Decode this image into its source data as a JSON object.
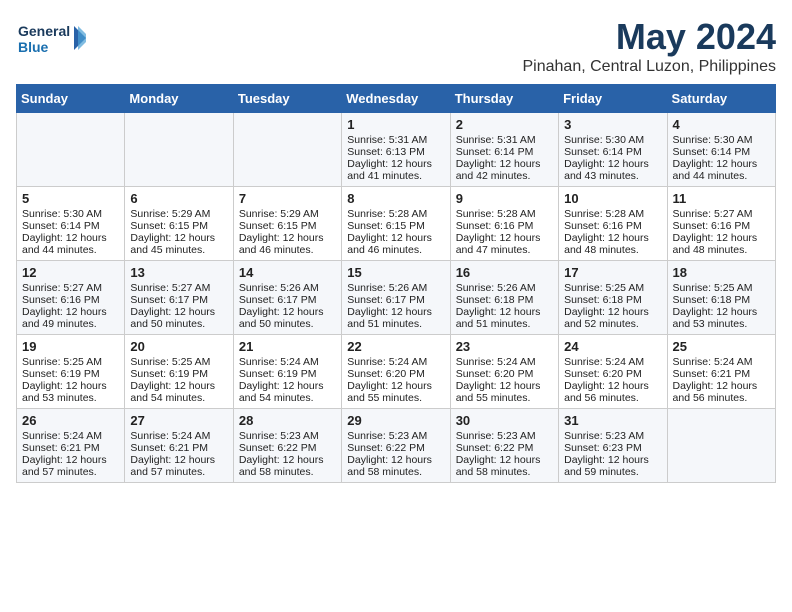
{
  "logo": {
    "line1": "General",
    "line2": "Blue"
  },
  "title": "May 2024",
  "subtitle": "Pinahan, Central Luzon, Philippines",
  "days_of_week": [
    "Sunday",
    "Monday",
    "Tuesday",
    "Wednesday",
    "Thursday",
    "Friday",
    "Saturday"
  ],
  "weeks": [
    [
      {
        "day": "",
        "sunrise": "",
        "sunset": "",
        "daylight": ""
      },
      {
        "day": "",
        "sunrise": "",
        "sunset": "",
        "daylight": ""
      },
      {
        "day": "",
        "sunrise": "",
        "sunset": "",
        "daylight": ""
      },
      {
        "day": "1",
        "sunrise": "Sunrise: 5:31 AM",
        "sunset": "Sunset: 6:13 PM",
        "daylight": "Daylight: 12 hours and 41 minutes."
      },
      {
        "day": "2",
        "sunrise": "Sunrise: 5:31 AM",
        "sunset": "Sunset: 6:14 PM",
        "daylight": "Daylight: 12 hours and 42 minutes."
      },
      {
        "day": "3",
        "sunrise": "Sunrise: 5:30 AM",
        "sunset": "Sunset: 6:14 PM",
        "daylight": "Daylight: 12 hours and 43 minutes."
      },
      {
        "day": "4",
        "sunrise": "Sunrise: 5:30 AM",
        "sunset": "Sunset: 6:14 PM",
        "daylight": "Daylight: 12 hours and 44 minutes."
      }
    ],
    [
      {
        "day": "5",
        "sunrise": "Sunrise: 5:30 AM",
        "sunset": "Sunset: 6:14 PM",
        "daylight": "Daylight: 12 hours and 44 minutes."
      },
      {
        "day": "6",
        "sunrise": "Sunrise: 5:29 AM",
        "sunset": "Sunset: 6:15 PM",
        "daylight": "Daylight: 12 hours and 45 minutes."
      },
      {
        "day": "7",
        "sunrise": "Sunrise: 5:29 AM",
        "sunset": "Sunset: 6:15 PM",
        "daylight": "Daylight: 12 hours and 46 minutes."
      },
      {
        "day": "8",
        "sunrise": "Sunrise: 5:28 AM",
        "sunset": "Sunset: 6:15 PM",
        "daylight": "Daylight: 12 hours and 46 minutes."
      },
      {
        "day": "9",
        "sunrise": "Sunrise: 5:28 AM",
        "sunset": "Sunset: 6:16 PM",
        "daylight": "Daylight: 12 hours and 47 minutes."
      },
      {
        "day": "10",
        "sunrise": "Sunrise: 5:28 AM",
        "sunset": "Sunset: 6:16 PM",
        "daylight": "Daylight: 12 hours and 48 minutes."
      },
      {
        "day": "11",
        "sunrise": "Sunrise: 5:27 AM",
        "sunset": "Sunset: 6:16 PM",
        "daylight": "Daylight: 12 hours and 48 minutes."
      }
    ],
    [
      {
        "day": "12",
        "sunrise": "Sunrise: 5:27 AM",
        "sunset": "Sunset: 6:16 PM",
        "daylight": "Daylight: 12 hours and 49 minutes."
      },
      {
        "day": "13",
        "sunrise": "Sunrise: 5:27 AM",
        "sunset": "Sunset: 6:17 PM",
        "daylight": "Daylight: 12 hours and 50 minutes."
      },
      {
        "day": "14",
        "sunrise": "Sunrise: 5:26 AM",
        "sunset": "Sunset: 6:17 PM",
        "daylight": "Daylight: 12 hours and 50 minutes."
      },
      {
        "day": "15",
        "sunrise": "Sunrise: 5:26 AM",
        "sunset": "Sunset: 6:17 PM",
        "daylight": "Daylight: 12 hours and 51 minutes."
      },
      {
        "day": "16",
        "sunrise": "Sunrise: 5:26 AM",
        "sunset": "Sunset: 6:18 PM",
        "daylight": "Daylight: 12 hours and 51 minutes."
      },
      {
        "day": "17",
        "sunrise": "Sunrise: 5:25 AM",
        "sunset": "Sunset: 6:18 PM",
        "daylight": "Daylight: 12 hours and 52 minutes."
      },
      {
        "day": "18",
        "sunrise": "Sunrise: 5:25 AM",
        "sunset": "Sunset: 6:18 PM",
        "daylight": "Daylight: 12 hours and 53 minutes."
      }
    ],
    [
      {
        "day": "19",
        "sunrise": "Sunrise: 5:25 AM",
        "sunset": "Sunset: 6:19 PM",
        "daylight": "Daylight: 12 hours and 53 minutes."
      },
      {
        "day": "20",
        "sunrise": "Sunrise: 5:25 AM",
        "sunset": "Sunset: 6:19 PM",
        "daylight": "Daylight: 12 hours and 54 minutes."
      },
      {
        "day": "21",
        "sunrise": "Sunrise: 5:24 AM",
        "sunset": "Sunset: 6:19 PM",
        "daylight": "Daylight: 12 hours and 54 minutes."
      },
      {
        "day": "22",
        "sunrise": "Sunrise: 5:24 AM",
        "sunset": "Sunset: 6:20 PM",
        "daylight": "Daylight: 12 hours and 55 minutes."
      },
      {
        "day": "23",
        "sunrise": "Sunrise: 5:24 AM",
        "sunset": "Sunset: 6:20 PM",
        "daylight": "Daylight: 12 hours and 55 minutes."
      },
      {
        "day": "24",
        "sunrise": "Sunrise: 5:24 AM",
        "sunset": "Sunset: 6:20 PM",
        "daylight": "Daylight: 12 hours and 56 minutes."
      },
      {
        "day": "25",
        "sunrise": "Sunrise: 5:24 AM",
        "sunset": "Sunset: 6:21 PM",
        "daylight": "Daylight: 12 hours and 56 minutes."
      }
    ],
    [
      {
        "day": "26",
        "sunrise": "Sunrise: 5:24 AM",
        "sunset": "Sunset: 6:21 PM",
        "daylight": "Daylight: 12 hours and 57 minutes."
      },
      {
        "day": "27",
        "sunrise": "Sunrise: 5:24 AM",
        "sunset": "Sunset: 6:21 PM",
        "daylight": "Daylight: 12 hours and 57 minutes."
      },
      {
        "day": "28",
        "sunrise": "Sunrise: 5:23 AM",
        "sunset": "Sunset: 6:22 PM",
        "daylight": "Daylight: 12 hours and 58 minutes."
      },
      {
        "day": "29",
        "sunrise": "Sunrise: 5:23 AM",
        "sunset": "Sunset: 6:22 PM",
        "daylight": "Daylight: 12 hours and 58 minutes."
      },
      {
        "day": "30",
        "sunrise": "Sunrise: 5:23 AM",
        "sunset": "Sunset: 6:22 PM",
        "daylight": "Daylight: 12 hours and 58 minutes."
      },
      {
        "day": "31",
        "sunrise": "Sunrise: 5:23 AM",
        "sunset": "Sunset: 6:23 PM",
        "daylight": "Daylight: 12 hours and 59 minutes."
      },
      {
        "day": "",
        "sunrise": "",
        "sunset": "",
        "daylight": ""
      }
    ]
  ]
}
